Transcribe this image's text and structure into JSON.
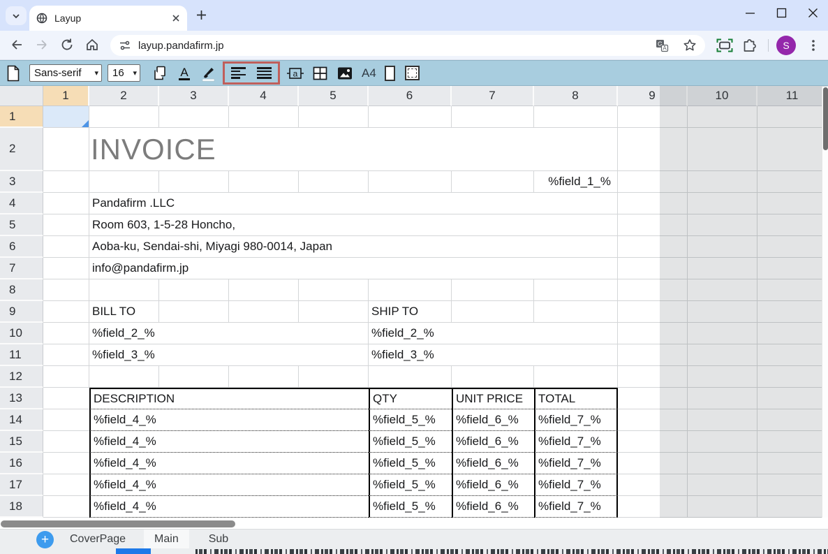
{
  "browser": {
    "tab_title": "Layup",
    "url": "layup.pandafirm.jp",
    "profile_initial": "S"
  },
  "icons": {
    "new_tab": "+",
    "add_sheet": "+",
    "select_caret": "▾"
  },
  "toolbar": {
    "font_value": "Sans-serif",
    "size_value": "16",
    "page_size_label": "A4",
    "highlight_box_color": "#c05f5b",
    "background_color": "#a8cddf",
    "icons": [
      "new-document",
      "copy",
      "font-color",
      "fill-color",
      "align-left",
      "align-justify",
      "text-box",
      "cell-borders",
      "insert-image",
      "page-size-a4",
      "page-orientation-portrait",
      "print-area"
    ]
  },
  "grid": {
    "column_headers": [
      "1",
      "2",
      "3",
      "4",
      "5",
      "6",
      "7",
      "8",
      "9",
      "10",
      "11"
    ],
    "row_headers": [
      "1",
      "2",
      "3",
      "4",
      "5",
      "6",
      "7",
      "8",
      "9",
      "10",
      "11",
      "12",
      "13",
      "14",
      "15",
      "16",
      "17",
      "18"
    ],
    "selected_column": "1",
    "selected_row": "1",
    "selected_cell_color": "#dbe9f9",
    "header_selected_color": "#f6ddb6"
  },
  "sheet": {
    "title": "INVOICE",
    "field1": "%field_1_%",
    "company": [
      "Pandafirm .LLC",
      "Room 603, 1-5-28 Honcho,",
      "Aoba-ku, Sendai-shi, Miyagi 980-0014, Japan",
      "info@pandafirm.jp"
    ],
    "bill_to": "BILL TO",
    "ship_to": "SHIP TO",
    "bill_fields": [
      "%field_2_%",
      "%field_3_%"
    ],
    "ship_fields": [
      "%field_2_%",
      "%field_3_%"
    ],
    "table": {
      "headers": [
        "DESCRIPTION",
        "QTY",
        "UNIT PRICE",
        "TOTAL"
      ],
      "row": [
        "%field_4_%",
        "%field_5_%",
        "%field_6_%",
        "%field_7_%"
      ],
      "data_row_count": 5
    }
  },
  "sheet_tabs": {
    "items": [
      "CoverPage",
      "Main",
      "Sub"
    ],
    "active": "Main"
  }
}
